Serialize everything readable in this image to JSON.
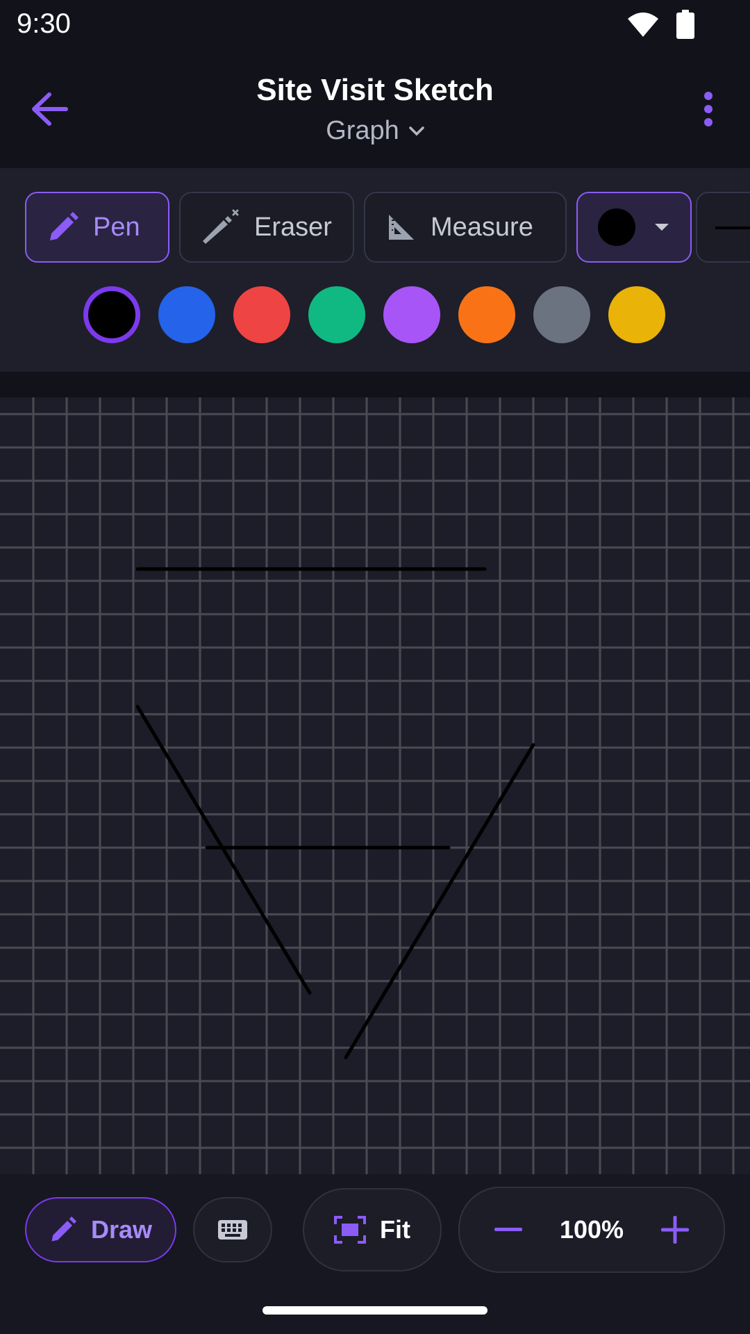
{
  "status_bar": {
    "time": "9:30",
    "icons": [
      "wifi-icon",
      "battery-icon"
    ]
  },
  "app_bar": {
    "title": "Site Visit Sketch",
    "subtitle": "Graph",
    "back_icon": "arrow-left-icon",
    "menu_icon": "more-vertical-icon"
  },
  "tools": [
    {
      "label": "Pen",
      "icon": "pencil-icon",
      "active": true
    },
    {
      "label": "Eraser",
      "icon": "eraser-wand-icon",
      "active": false
    },
    {
      "label": "Measure",
      "icon": "set-square-icon",
      "active": false
    }
  ],
  "color_picker": {
    "current": "#000000"
  },
  "palette": [
    "#000000",
    "#2563eb",
    "#ef4444",
    "#10b981",
    "#a855f7",
    "#f97316",
    "#6b7280",
    "#eab308"
  ],
  "selected_color_index": 0,
  "bottom_bar": {
    "draw_label": "Draw",
    "fit_label": "Fit",
    "zoom": "100%"
  },
  "colors": {
    "accent": "#8b5cf6",
    "background": "#12131a",
    "canvas": "#1c1d28",
    "grid": "#4a4b52"
  }
}
